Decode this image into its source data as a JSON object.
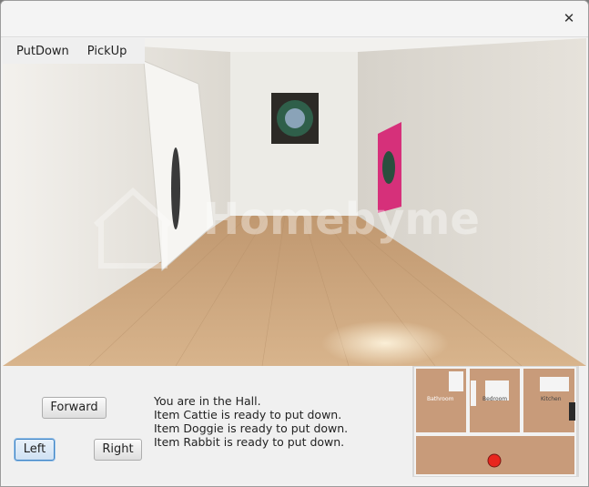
{
  "window": {
    "close_symbol": "✕"
  },
  "menu": {
    "items": [
      "PutDown",
      "PickUp"
    ]
  },
  "scene": {
    "watermark": "Homebyme"
  },
  "buttons": {
    "forward": "Forward",
    "left": "Left",
    "right": "Right"
  },
  "messages": [
    "You are in the Hall.",
    "Item Cattie is ready to put down.",
    "Item Doggie is ready to put down.",
    "Item Rabbit is ready to put down."
  ],
  "minimap": {
    "rooms": [
      "Bathroom",
      "Bedroom",
      "Kitchen"
    ],
    "player_color": "#e8261e",
    "current_room": "Hall"
  },
  "colors": {
    "accent": "#3b82c4",
    "floor": "#c9a47c",
    "wall": "#e9e6e0"
  }
}
